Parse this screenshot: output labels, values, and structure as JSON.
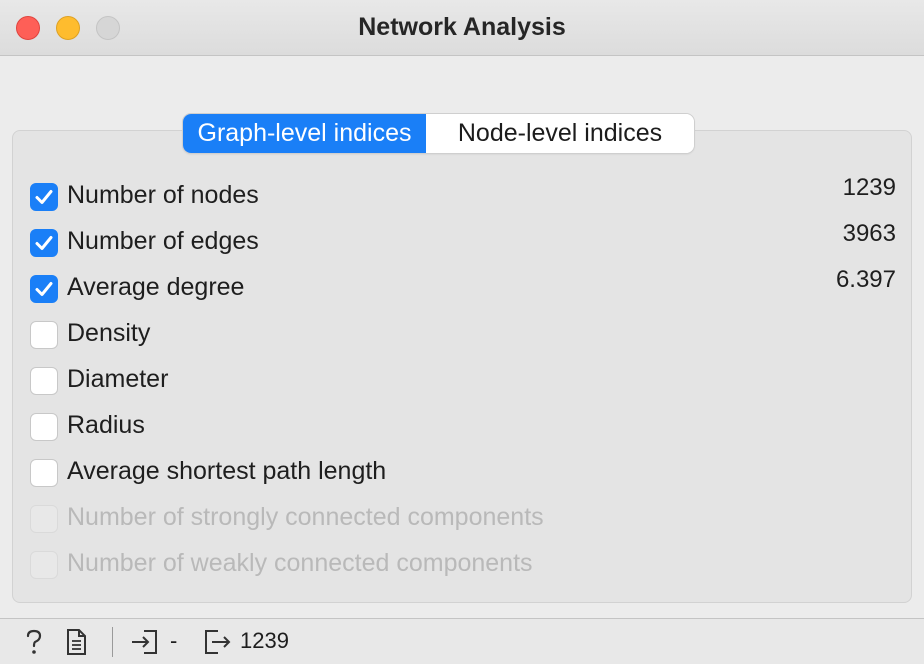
{
  "window": {
    "title": "Network Analysis"
  },
  "tabs": [
    {
      "label": "Graph-level indices",
      "active": true
    },
    {
      "label": "Node-level indices",
      "active": false
    }
  ],
  "indices": [
    {
      "label": "Number of nodes",
      "checked": true,
      "enabled": true,
      "value": "1239"
    },
    {
      "label": "Number of edges",
      "checked": true,
      "enabled": true,
      "value": "3963"
    },
    {
      "label": "Average degree",
      "checked": true,
      "enabled": true,
      "value": "6.397"
    },
    {
      "label": "Density",
      "checked": false,
      "enabled": true,
      "value": ""
    },
    {
      "label": "Diameter",
      "checked": false,
      "enabled": true,
      "value": ""
    },
    {
      "label": "Radius",
      "checked": false,
      "enabled": true,
      "value": ""
    },
    {
      "label": "Average shortest path length",
      "checked": false,
      "enabled": true,
      "value": ""
    },
    {
      "label": "Number of strongly connected components",
      "checked": false,
      "enabled": false,
      "value": ""
    },
    {
      "label": "Number of weakly connected components",
      "checked": false,
      "enabled": false,
      "value": ""
    }
  ],
  "statusbar": {
    "input_summary": "-",
    "output_summary": "1239"
  },
  "colors": {
    "accent": "#1a7ff7",
    "close": "#fe5f57",
    "minimize": "#febc2e",
    "maximize_disabled": "#d6d6d6"
  },
  "icons": {
    "help": "question-mark-icon",
    "report": "document-icon",
    "input": "input-arrow-icon",
    "output": "output-arrow-icon"
  }
}
